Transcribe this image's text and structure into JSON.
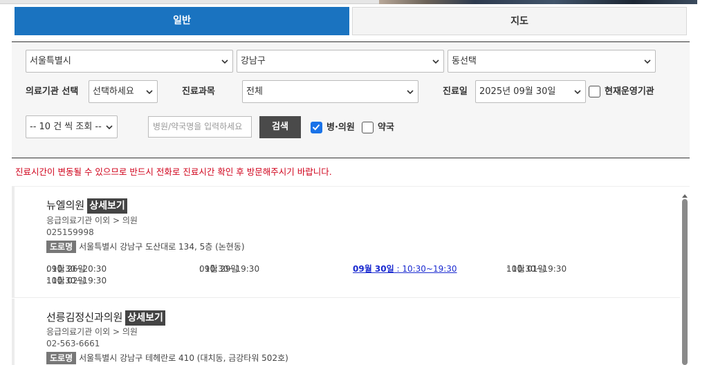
{
  "tabs": {
    "general": "일반",
    "map": "지도"
  },
  "filters": {
    "city": "서울특별시",
    "district": "강남구",
    "dong": "동선택",
    "institution_label": "의료기관 선택",
    "institution_value": "선택하세요",
    "dept_label": "진료과목",
    "dept_value": "전체",
    "date_label": "진료일",
    "date_value": "2025년 09월 30일",
    "open_now_label": "현재운영기관",
    "page_size": "-- 10 건 씩 조회 --",
    "search_placeholder": "병원/약국명을 입력하세요",
    "search_button": "검색",
    "hospital_label": "병·의원",
    "pharmacy_label": "약국"
  },
  "notice": "진료시간이 변동될 수 있으므로 반드시 전화로 진료시간 확인 후 방문해주시기 바랍니다.",
  "results": [
    {
      "name": "뉴엘의원",
      "detail": "상세보기",
      "category": "응급의료기관 이외 > 의원",
      "phone": "025159998",
      "road": "도로명",
      "address": "서울특별시 강남구 도산대로 134, 5층 (논현동)",
      "hours": [
        {
          "day": "09월 26일",
          "time": " : 10:30~20:30"
        },
        {
          "day": "09월 29일",
          "time": " : 10:30~19:30"
        },
        {
          "day": "09월 30일",
          "time": " : 10:30~19:30"
        },
        {
          "day": "10월 01일",
          "time": " : 10:30~19:30"
        },
        {
          "day": "10월 02일",
          "time": " : 10:30~19:30"
        }
      ]
    },
    {
      "name": "선릉김정신과의원",
      "detail": "상세보기",
      "category": "응급의료기관 이외 > 의원",
      "phone": "02-563-6661",
      "road": "도로명",
      "address": "서울특별시 강남구 테헤란로 410 (대치동, 금강타워 502호)"
    }
  ],
  "colors": {
    "accent": "#1a73c0",
    "notice": "#d0021b",
    "today": "#1a2ad0"
  }
}
